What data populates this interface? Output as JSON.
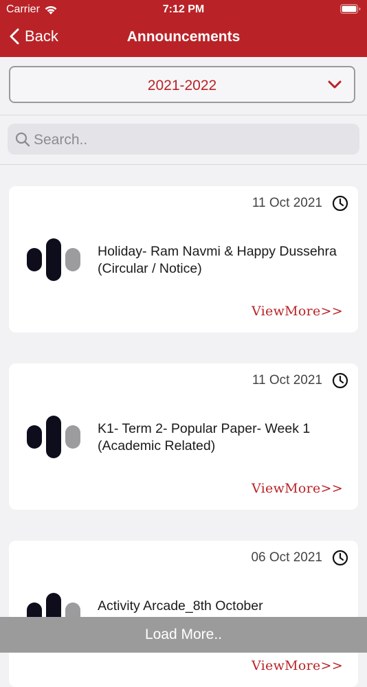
{
  "status_bar": {
    "carrier": "Carrier",
    "time": "7:12 PM"
  },
  "nav": {
    "back_label": "Back",
    "title": "Announcements"
  },
  "year_select": {
    "selected": "2021-2022"
  },
  "search": {
    "placeholder": "Search..",
    "value": ""
  },
  "announcements": [
    {
      "date": "11 Oct 2021",
      "title_line1": "Holiday- Ram Navmi & Happy Dussehra",
      "title_line2": "(Circular / Notice)",
      "view_more": "ViewMore>>"
    },
    {
      "date": "11 Oct 2021",
      "title_line1": "K1- Term 2- Popular Paper- Week 1",
      "title_line2": "(Academic Related)",
      "view_more": "ViewMore>>"
    },
    {
      "date": "06 Oct 2021",
      "title_line1": "Activity Arcade_8th October",
      "title_line2": "",
      "view_more": "ViewMore>>"
    }
  ],
  "load_more_label": "Load More..",
  "colors": {
    "accent": "#b92327",
    "background": "#f2f2f4",
    "load_more_bg": "#9b9b9b"
  }
}
